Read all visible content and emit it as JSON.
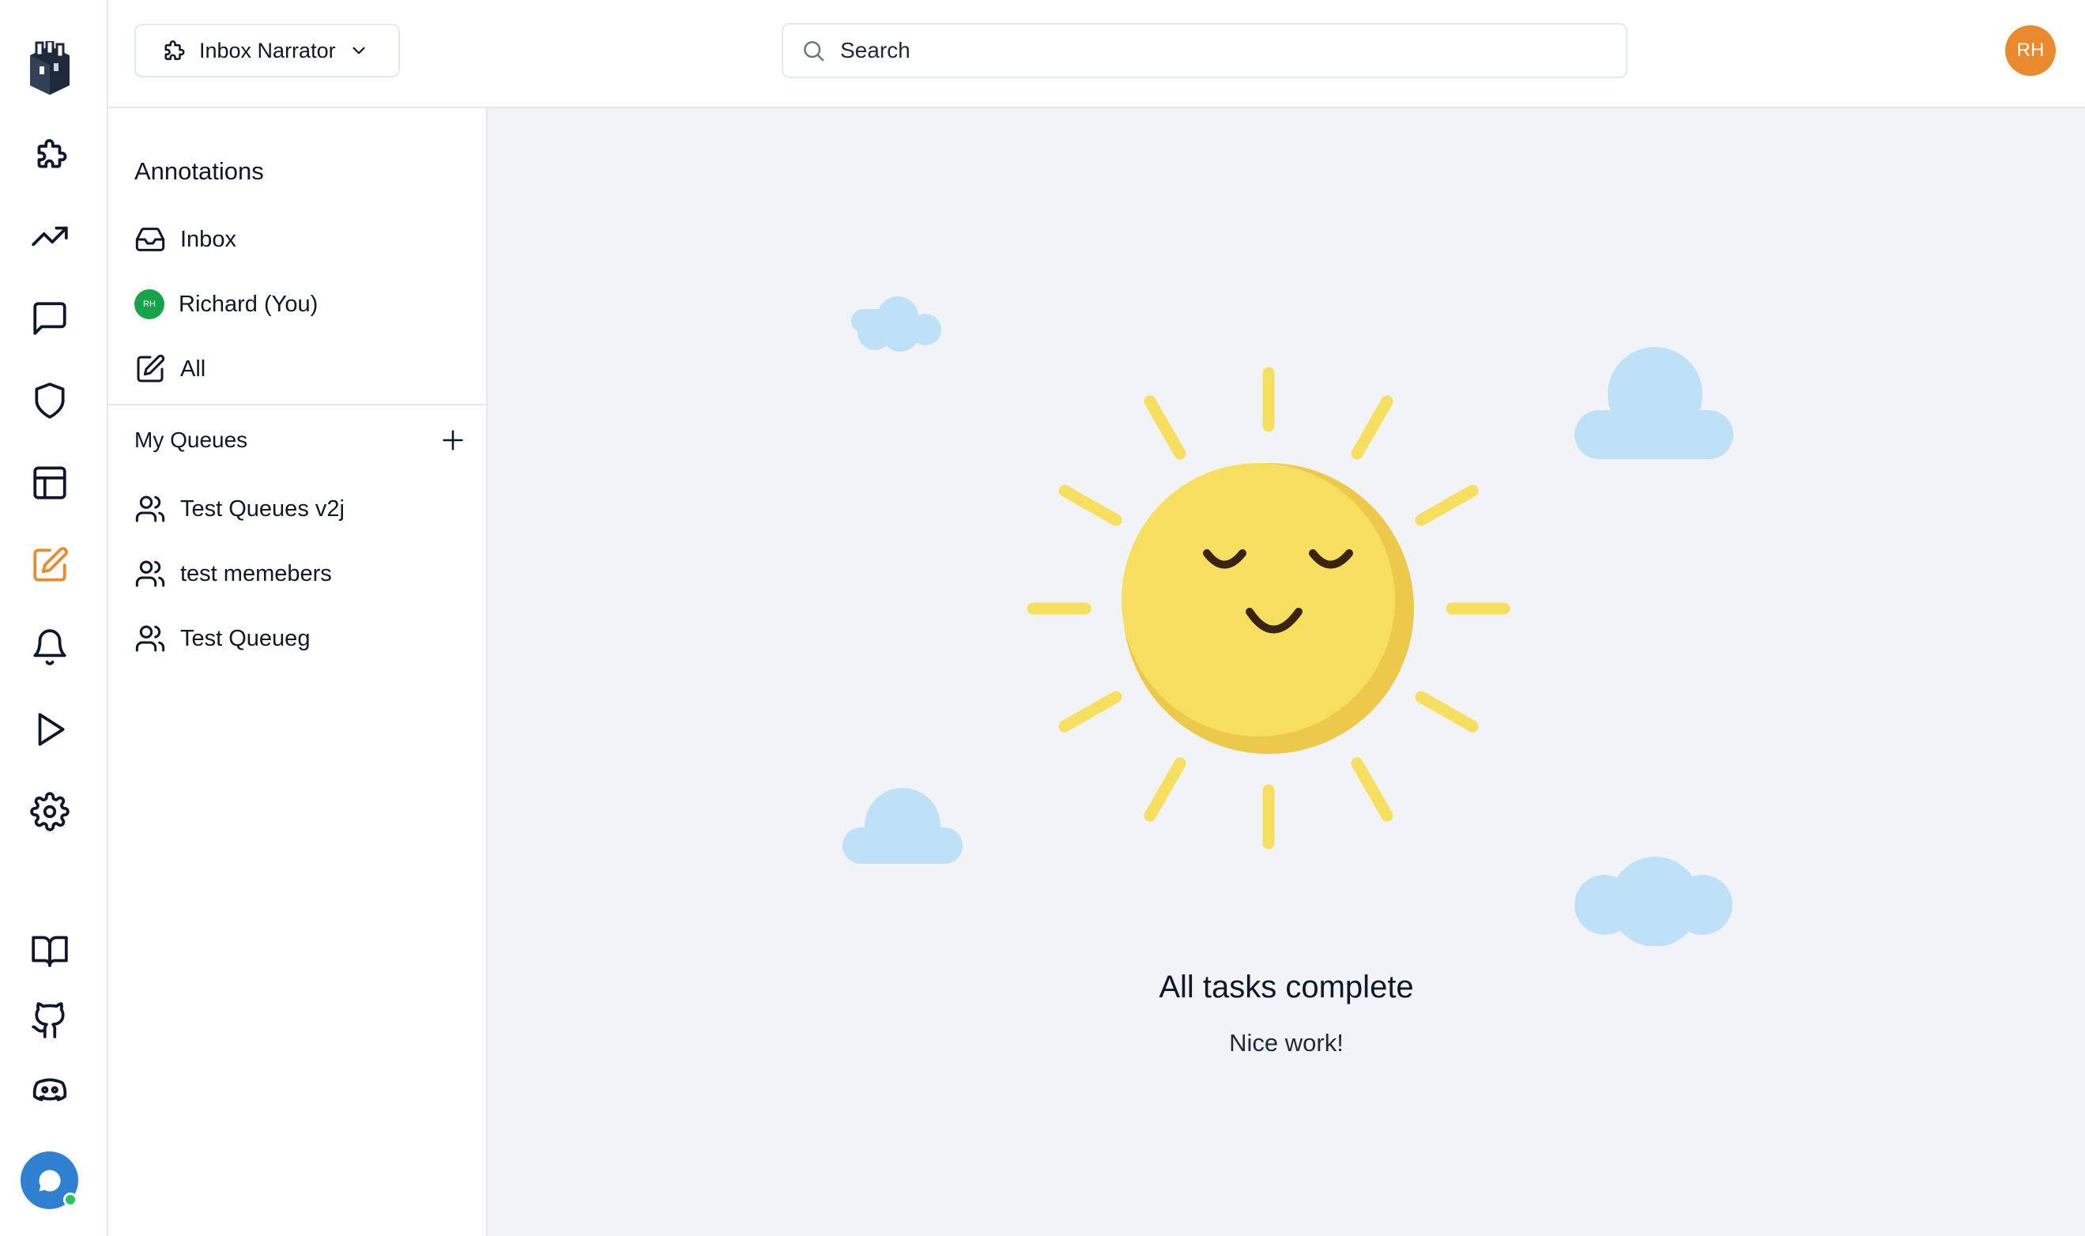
{
  "rail": {
    "icons": [
      {
        "name": "puzzle-icon"
      },
      {
        "name": "trending-up-icon"
      },
      {
        "name": "message-square-icon"
      },
      {
        "name": "shield-icon"
      },
      {
        "name": "table-icon"
      },
      {
        "name": "edit-icon",
        "active": true
      },
      {
        "name": "bell-icon"
      },
      {
        "name": "play-icon"
      },
      {
        "name": "settings-icon"
      },
      {
        "name": "book-icon"
      },
      {
        "name": "github-icon"
      },
      {
        "name": "discord-icon"
      }
    ],
    "active_color": "#ea8a2f",
    "chat_color": "#2f80d1"
  },
  "header": {
    "project_name": "Inbox Narrator",
    "search_placeholder": "Search",
    "user_initials": "RH",
    "avatar_color": "#ea8a2f"
  },
  "sidebar": {
    "heading": "Annotations",
    "items": [
      {
        "label": "Inbox",
        "icon": "inbox-icon"
      },
      {
        "label": "Richard (You)",
        "icon": "avatar",
        "initials": "RH"
      },
      {
        "label": "All",
        "icon": "edit-icon"
      }
    ],
    "queues_heading": "My Queues",
    "queues": [
      {
        "label": "Test Queues v2j",
        "icon": "users-icon"
      },
      {
        "label": "test memebers",
        "icon": "users-icon"
      },
      {
        "label": "Test Queueg",
        "icon": "users-icon"
      }
    ]
  },
  "main": {
    "empty_title": "All tasks complete",
    "empty_subtitle": "Nice work!",
    "sun_color": "#f6de5e",
    "cloud_color": "#bfe1f8"
  }
}
